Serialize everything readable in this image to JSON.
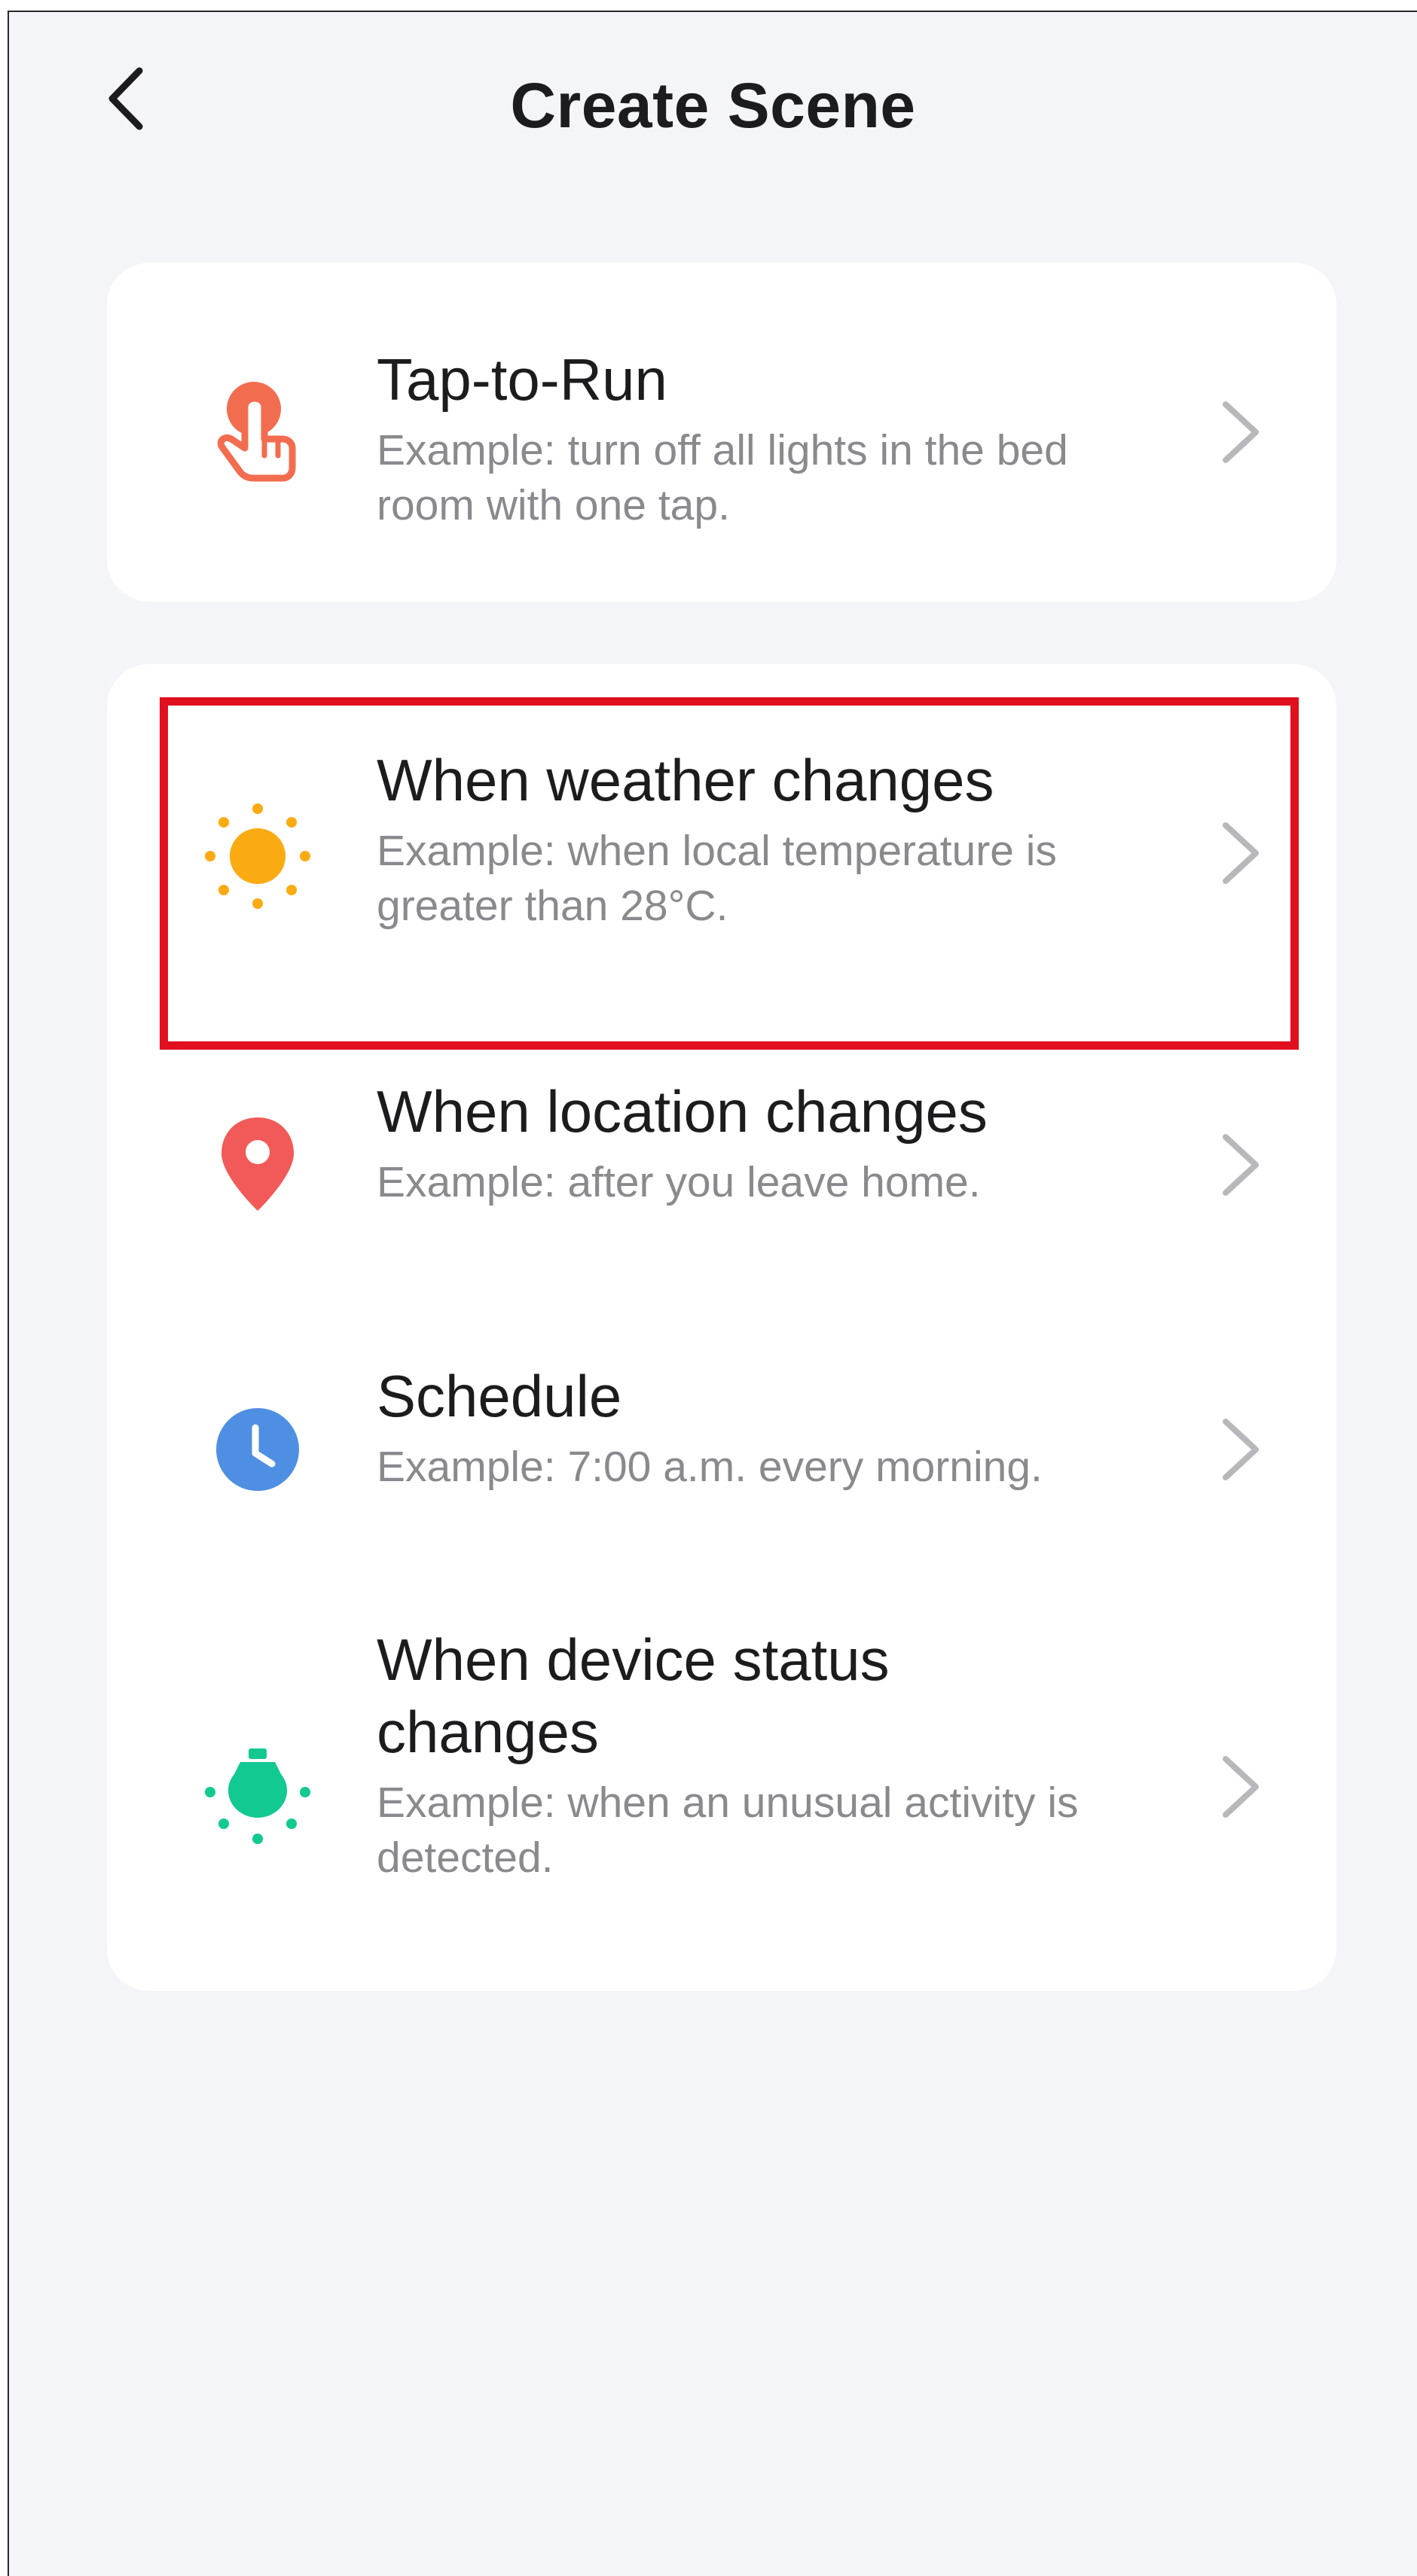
{
  "header": {
    "title": "Create Scene"
  },
  "colors": {
    "background": "#f4f5f9",
    "card": "#ffffff",
    "title": "#1c1c1e",
    "description": "#8a8a8e",
    "chevron": "#b8b8bc",
    "highlight": "#e0101e",
    "tap_icon": "#f26d4f",
    "weather_icon": "#fbab12",
    "location_icon": "#f15a58",
    "schedule_icon": "#4f8fe3",
    "device_icon": "#12c992"
  },
  "cards": [
    {
      "items": [
        {
          "icon": "hand-tap-icon",
          "title": "Tap-to-Run",
          "description": "Example: turn off all lights in the bed\nroom with one tap."
        }
      ]
    },
    {
      "items": [
        {
          "icon": "sun-icon",
          "title": "When weather changes",
          "description": "Example: when local temperature is\ngreater than 28°C."
        },
        {
          "icon": "location-pin-icon",
          "title": "When location changes",
          "description": "Example: after you leave home."
        },
        {
          "icon": "clock-icon",
          "title": "Schedule",
          "description": "Example: 7:00 a.m. every morning."
        },
        {
          "icon": "device-bulb-icon",
          "title": "When device status\nchanges",
          "description": "Example: when an unusual activity is\n detected."
        }
      ]
    }
  ]
}
